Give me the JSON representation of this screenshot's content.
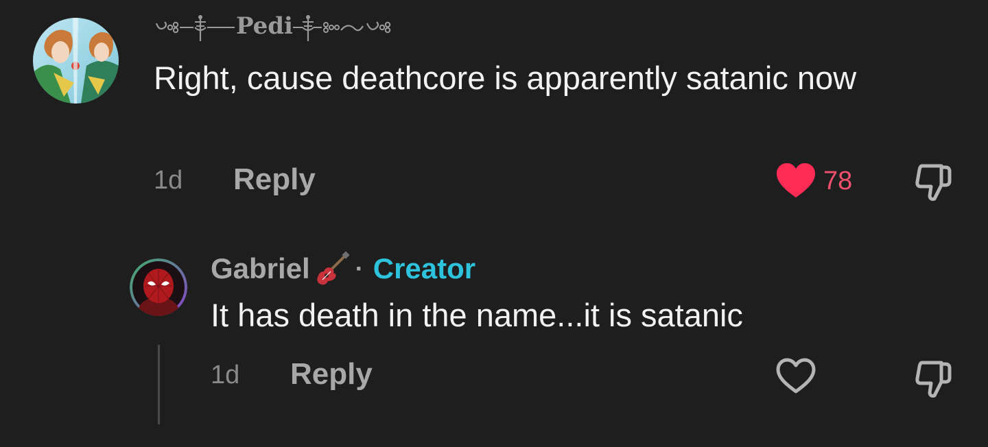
{
  "comments": [
    {
      "username_display": "Pedi",
      "username_decoration": "ornamental-flourish",
      "avatar_icon": "anime-character-avatar-icon",
      "text": "Right, cause deathcore is apparently satanic now",
      "time": "1d",
      "reply_label": "Reply",
      "liked": true,
      "like_count": "78",
      "like_color": "#fe2c55",
      "like_icon": "heart-filled-icon",
      "dislike_icon": "thumbs-down-icon"
    },
    {
      "username": "Gabriel",
      "username_emoji": "guitar-icon",
      "separator": "·",
      "badge": "Creator",
      "badge_color": "#2ec3dc",
      "avatar_icon": "spider-mask-avatar-icon",
      "text": "It has death in the name...it is satanic",
      "time": "1d",
      "reply_label": "Reply",
      "liked": false,
      "like_icon": "heart-outline-icon",
      "dislike_icon": "thumbs-down-icon"
    }
  ],
  "colors": {
    "background": "#1e1e1e",
    "text_primary": "#f2f2f2",
    "text_secondary": "#a8a8a8",
    "creator_accent": "#2ec3dc",
    "like_accent": "#fe2c55"
  }
}
